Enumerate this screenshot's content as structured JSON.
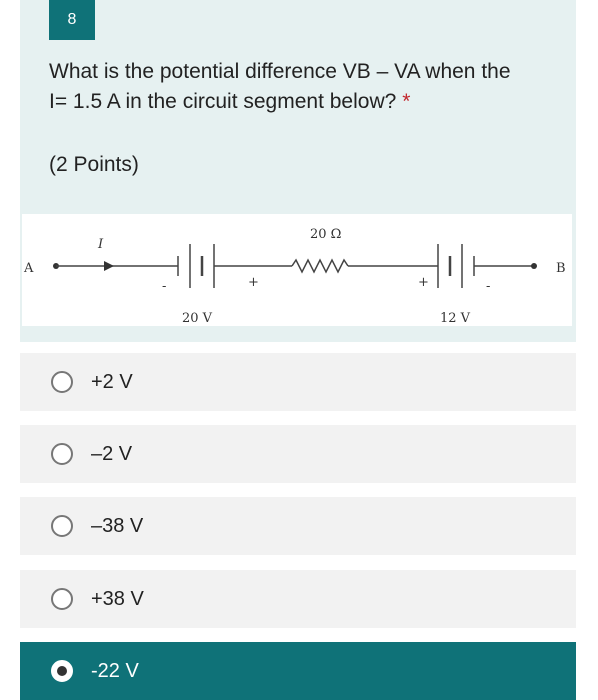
{
  "question": {
    "number": "8",
    "text": "What is the potential difference VB – VA when the I= 1.5 A in the circuit segment below?",
    "required_mark": "*",
    "points": "(2 Points)"
  },
  "circuit": {
    "label_a": "A",
    "label_b": "B",
    "current_label": "I",
    "resistor_label": "20 Ω",
    "battery1_label": "20 V",
    "battery2_label": "12 V",
    "plus": "+",
    "minus": "-"
  },
  "options": [
    {
      "label": "+2 V",
      "selected": false
    },
    {
      "label": "–2 V",
      "selected": false
    },
    {
      "label": "–38 V",
      "selected": false
    },
    {
      "label": "+38 V",
      "selected": false
    },
    {
      "label": "-22 V",
      "selected": true
    }
  ],
  "colors": {
    "accent": "#0f7278",
    "card_bg": "#e6f1f1",
    "option_bg": "#f2f2f2",
    "required": "#c2272d"
  }
}
